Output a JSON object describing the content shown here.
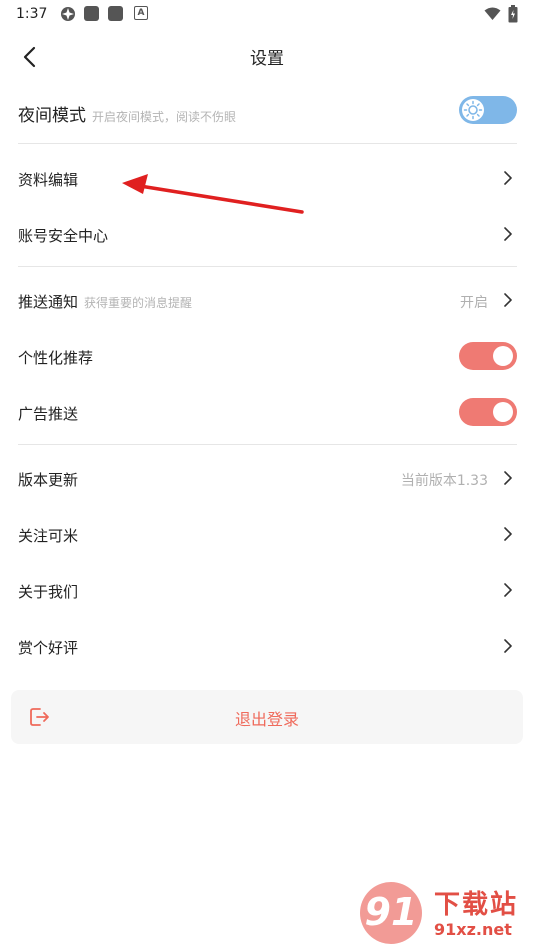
{
  "status_bar": {
    "time": "1:37",
    "icons": [
      "app-icon",
      "square-icon",
      "square-icon",
      "a-icon",
      "wifi-icon",
      "battery-icon"
    ],
    "a_glyph": "A"
  },
  "header": {
    "title": "设置"
  },
  "night_mode": {
    "label": "夜间模式",
    "hint": "开启夜间模式，阅读不伤眼",
    "enabled": false
  },
  "profile_edit": {
    "label": "资料编辑"
  },
  "account_security": {
    "label": "账号安全中心"
  },
  "push_notify": {
    "label": "推送通知",
    "hint": "获得重要的消息提醒",
    "value": "开启"
  },
  "personalized": {
    "label": "个性化推荐",
    "enabled": true
  },
  "ad_push": {
    "label": "广告推送",
    "enabled": true
  },
  "version_update": {
    "label": "版本更新",
    "value": "当前版本1.33"
  },
  "follow": {
    "label": "关注可米"
  },
  "about": {
    "label": "关于我们"
  },
  "rate": {
    "label": "赏个好评"
  },
  "logout": {
    "label": "退出登录"
  },
  "watermark": {
    "title": "下载站",
    "url": "91xz.net",
    "badge": "91"
  },
  "colors": {
    "accent": "#ef7a73",
    "logout_text": "#ef6a5b",
    "night_toggle": "#7fb7e8",
    "arrow": "#e02020"
  }
}
